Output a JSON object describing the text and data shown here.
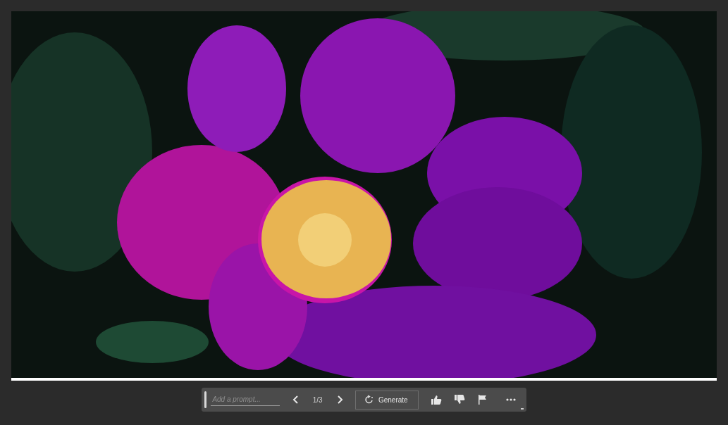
{
  "toolbar": {
    "prompt": {
      "placeholder": "Add a prompt..."
    },
    "page": "1/3",
    "generate": "Generate"
  }
}
